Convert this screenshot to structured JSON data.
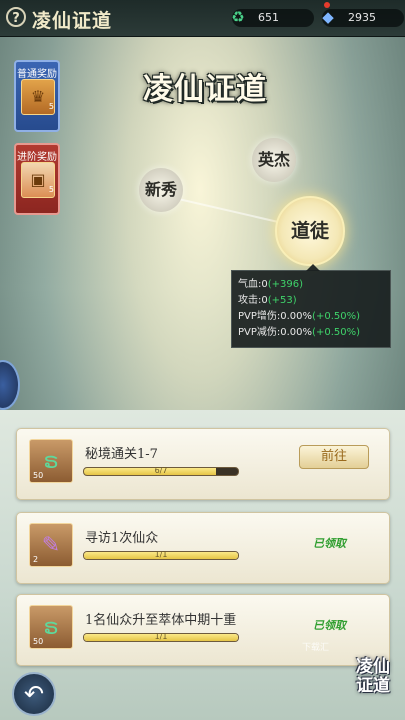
{
  "header": {
    "help_symbol": "?",
    "title": "凌仙证道",
    "currency1": {
      "icon": "jade-icon",
      "value": "651"
    },
    "currency2": {
      "icon": "crystal-icon",
      "value": "2935"
    }
  },
  "rewards": {
    "normal": {
      "label": "普通奖励",
      "count": "5"
    },
    "advanced": {
      "label": "进阶奖励",
      "count": "5"
    }
  },
  "logo_text": "凌仙证道",
  "ranks": {
    "rank1": "新秀",
    "rank2": "英杰",
    "rank3": "道徒"
  },
  "tooltip": {
    "row1_label": "气血:0",
    "row1_bonus": "(+396)",
    "row2_label": "攻击:0",
    "row2_bonus": "(+53)",
    "row3_label": "PVP增伤:0.00%",
    "row3_bonus": "(+0.50%)",
    "row4_label": "PVP减伤:0.00%",
    "row4_bonus": "(+0.50%)"
  },
  "tasks": [
    {
      "name": "秘境通关1-7",
      "progress_text": "6/7",
      "progress": 0.857,
      "icon_count": "50",
      "action": "前往",
      "icon": "dragon-icon"
    },
    {
      "name": "寻访1次仙众",
      "progress_text": "1/1",
      "progress": 1.0,
      "icon_count": "2",
      "action": "已领取",
      "icon": "feather-icon"
    },
    {
      "name": "1名仙众升至萃体中期十重",
      "progress_text": "1/1",
      "progress": 1.0,
      "icon_count": "50",
      "action": "已领取",
      "icon": "dragon-icon"
    }
  ],
  "watermark": "下载汇",
  "footer": {
    "back_symbol": "↶",
    "corner_logo_line1": "凌仙",
    "corner_logo_line2": "证道"
  }
}
